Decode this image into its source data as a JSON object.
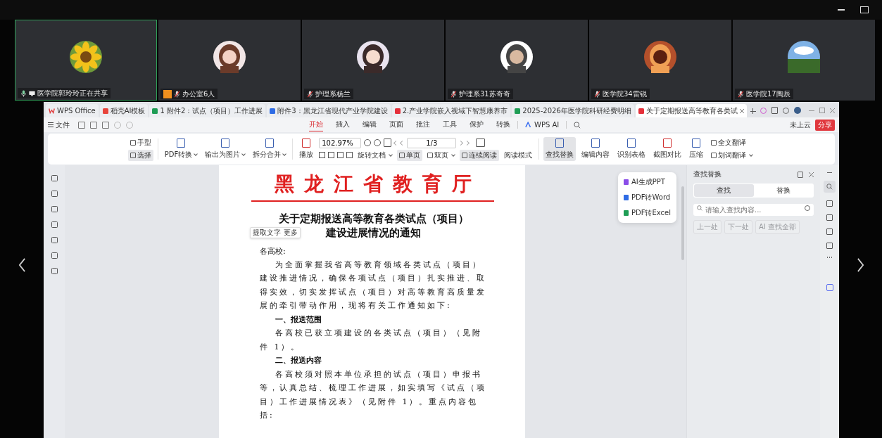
{
  "participants": [
    {
      "name": "医学院郭玲玲正在共享",
      "selected": true,
      "muted": false,
      "sharing": true,
      "host_badge": false
    },
    {
      "name": "办公室6人",
      "selected": false,
      "muted": true,
      "sharing": false,
      "host_badge": true
    },
    {
      "name": "护理系杨兰",
      "selected": false,
      "muted": true,
      "sharing": false,
      "host_badge": false
    },
    {
      "name": "护理系31苏奇奇",
      "selected": false,
      "muted": true,
      "sharing": false,
      "host_badge": false
    },
    {
      "name": "医学院34雷锐",
      "selected": false,
      "muted": true,
      "sharing": false,
      "host_badge": false
    },
    {
      "name": "医学院17陶辰",
      "selected": false,
      "muted": true,
      "sharing": false,
      "host_badge": false
    }
  ],
  "tabs": [
    {
      "label": "WPS Office",
      "kind": "home",
      "selected": false
    },
    {
      "label": "稻壳AI模板",
      "kind": "template",
      "selected": false
    },
    {
      "label": "1 附件2：试点（项目）工作进展",
      "kind": "sheet",
      "selected": false
    },
    {
      "label": "附件3：黑龙江省现代产业学院建设",
      "kind": "writer",
      "selected": false
    },
    {
      "label": "2.产业学院嵌入视域下智慧康养市",
      "kind": "pdf",
      "selected": false
    },
    {
      "label": "2025-2026年医学院科研经费明细",
      "kind": "sheet",
      "selected": false
    },
    {
      "label": "关于定期报送高等教育各类试",
      "kind": "pdf",
      "selected": true
    }
  ],
  "menu": {
    "file": "文件",
    "items": [
      {
        "label": "开始",
        "selected": true
      },
      {
        "label": "插入",
        "selected": false
      },
      {
        "label": "编辑",
        "selected": false
      },
      {
        "label": "页面",
        "selected": false
      },
      {
        "label": "批注",
        "selected": false
      },
      {
        "label": "工具",
        "selected": false
      },
      {
        "label": "保护",
        "selected": false
      },
      {
        "label": "转换",
        "selected": false
      }
    ],
    "ai": "WPS AI",
    "cloud": "未上云",
    "share": "分享"
  },
  "ribbon": {
    "modes": [
      {
        "label": "手型",
        "selected": false
      },
      {
        "label": "选择",
        "selected": true
      }
    ],
    "convert": [
      {
        "label": "PDF转换",
        "dropdown": true
      },
      {
        "label": "输出为图片",
        "dropdown": true
      },
      {
        "label": "拆分合并",
        "dropdown": true
      }
    ],
    "play": "播放",
    "zoom": "102.97%",
    "page": "1/3",
    "views": [
      {
        "label": "旋转文档",
        "selected": false,
        "dropdown": true
      },
      {
        "label": "单页",
        "selected": true,
        "dropdown": false
      },
      {
        "label": "双页",
        "selected": false,
        "dropdown": true
      },
      {
        "label": "连续阅读",
        "selected": true,
        "dropdown": false
      }
    ],
    "reading": "阅读模式",
    "tools": [
      {
        "label": "查找替换",
        "selected": true
      },
      {
        "label": "编辑内容",
        "selected": false
      },
      {
        "label": "识别表格",
        "selected": false
      },
      {
        "label": "截图对比",
        "selected": false
      },
      {
        "label": "压缩",
        "selected": false
      }
    ],
    "translate": [
      {
        "label": "全文翻译",
        "dropdown": false
      },
      {
        "label": "划词翻译",
        "dropdown": true
      }
    ]
  },
  "document": {
    "header": "黑龙江省教育厅",
    "title": [
      "关于定期报送高等教育各类试点（项目）",
      "建设进展情况的通知"
    ],
    "selection_popup": [
      "提取文字",
      "更多"
    ],
    "blocks": [
      {
        "kind": "salutation",
        "text": "各高校:"
      },
      {
        "kind": "paragraph",
        "text": "为全面掌握我省高等教育领域各类试点（项目）建设推进情况，确保各项试点（项目）扎实推进、取得实效，切实发挥试点（项目）对高等教育高质量发展的牵引带动作用，现将有关工作通知如下:"
      },
      {
        "kind": "heading",
        "text": "一、报送范围"
      },
      {
        "kind": "paragraph",
        "text": "各高校已获立项建设的各类试点（项目）（见附件 1）。"
      },
      {
        "kind": "heading",
        "text": "二、报送内容"
      },
      {
        "kind": "paragraph",
        "text": "各高校须对照本单位承担的试点（项目）申报书等，认真总结、梳理工作进展，如实填写《试点（项目）工作进展情况表》（见附件 1）。重点内容包括:"
      }
    ]
  },
  "quick_actions": [
    "AI生成PPT",
    "PDF转Word",
    "PDF转Excel"
  ],
  "find_panel": {
    "title": "查找替换",
    "tabs": [
      {
        "label": "查找",
        "selected": true
      },
      {
        "label": "替换",
        "selected": false
      }
    ],
    "placeholder": "请输入查找内容...",
    "buttons": [
      {
        "label": "上一处",
        "disabled": true
      },
      {
        "label": "下一处",
        "disabled": true
      },
      {
        "label": "AI 查找全部",
        "disabled": true
      }
    ]
  }
}
